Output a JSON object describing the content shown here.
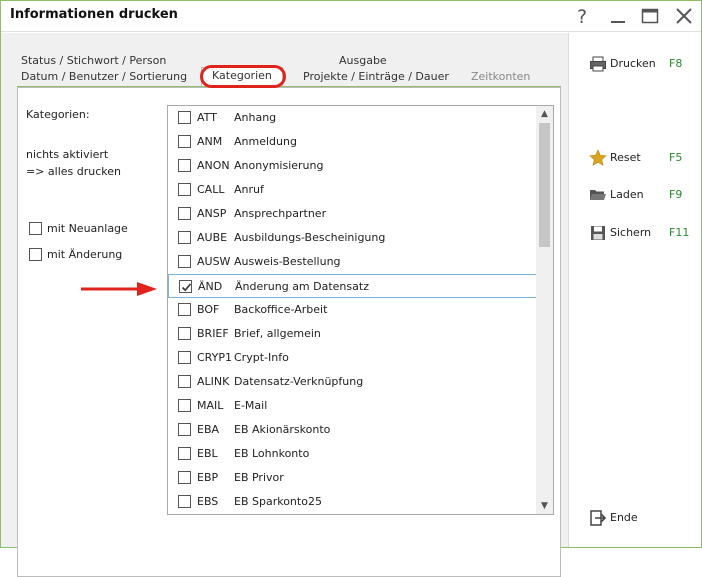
{
  "window": {
    "title": "Informationen drucken"
  },
  "tabs": {
    "back": [
      "Status / Stichwort / Person",
      "Ausgabe"
    ],
    "front": [
      "Datum / Benutzer / Sortierung",
      "Kategorien",
      "Projekte / Einträge / Dauer",
      "Zeitkonten"
    ]
  },
  "left": {
    "kategorien_label": "Kategorien:",
    "hint_line1": "nichts aktiviert",
    "hint_line2": "=> alles drucken",
    "mit_neuanlage": "mit Neuanlage",
    "mit_aenderung": "mit Änderung"
  },
  "list": {
    "rows": [
      {
        "code": "ATT",
        "desc": "Anhang",
        "checked": false
      },
      {
        "code": "ANM",
        "desc": "Anmeldung",
        "checked": false
      },
      {
        "code": "ANON",
        "desc": "Anonymisierung",
        "checked": false
      },
      {
        "code": "CALL",
        "desc": "Anruf",
        "checked": false
      },
      {
        "code": "ANSP",
        "desc": "Ansprechpartner",
        "checked": false
      },
      {
        "code": "AUBE",
        "desc": "Ausbildungs-Bescheinigung",
        "checked": false
      },
      {
        "code": "AUSW",
        "desc": "Ausweis-Bestellung",
        "checked": false
      },
      {
        "code": "ÄND",
        "desc": "Änderung am Datensatz",
        "checked": true
      },
      {
        "code": "BOF",
        "desc": "Backoffice-Arbeit",
        "checked": false
      },
      {
        "code": "BRIEF",
        "desc": "Brief, allgemein",
        "checked": false
      },
      {
        "code": "CRYP1",
        "desc": "Crypt-Info",
        "checked": false
      },
      {
        "code": "ALINK",
        "desc": "Datensatz-Verknüpfung",
        "checked": false
      },
      {
        "code": "MAIL",
        "desc": "E-Mail",
        "checked": false
      },
      {
        "code": "EBA",
        "desc": "EB Akionärskonto",
        "checked": false
      },
      {
        "code": "EBL",
        "desc": "EB Lohnkonto",
        "checked": false
      },
      {
        "code": "EBP",
        "desc": "EB Privor",
        "checked": false
      },
      {
        "code": "EBS",
        "desc": "EB Sparkonto25",
        "checked": false
      }
    ]
  },
  "actions": {
    "drucken": {
      "label": "Drucken",
      "key": "F8"
    },
    "reset": {
      "label": "Reset",
      "key": "F5"
    },
    "laden": {
      "label": "Laden",
      "key": "F9"
    },
    "sichern": {
      "label": "Sichern",
      "key": "F11"
    },
    "ende": {
      "label": "Ende"
    }
  },
  "colors": {
    "accent_green": "#8dbf6a",
    "highlight_red": "#e0241b",
    "key_green": "#2a8a2a",
    "selection_blue": "#7bb4e4"
  }
}
